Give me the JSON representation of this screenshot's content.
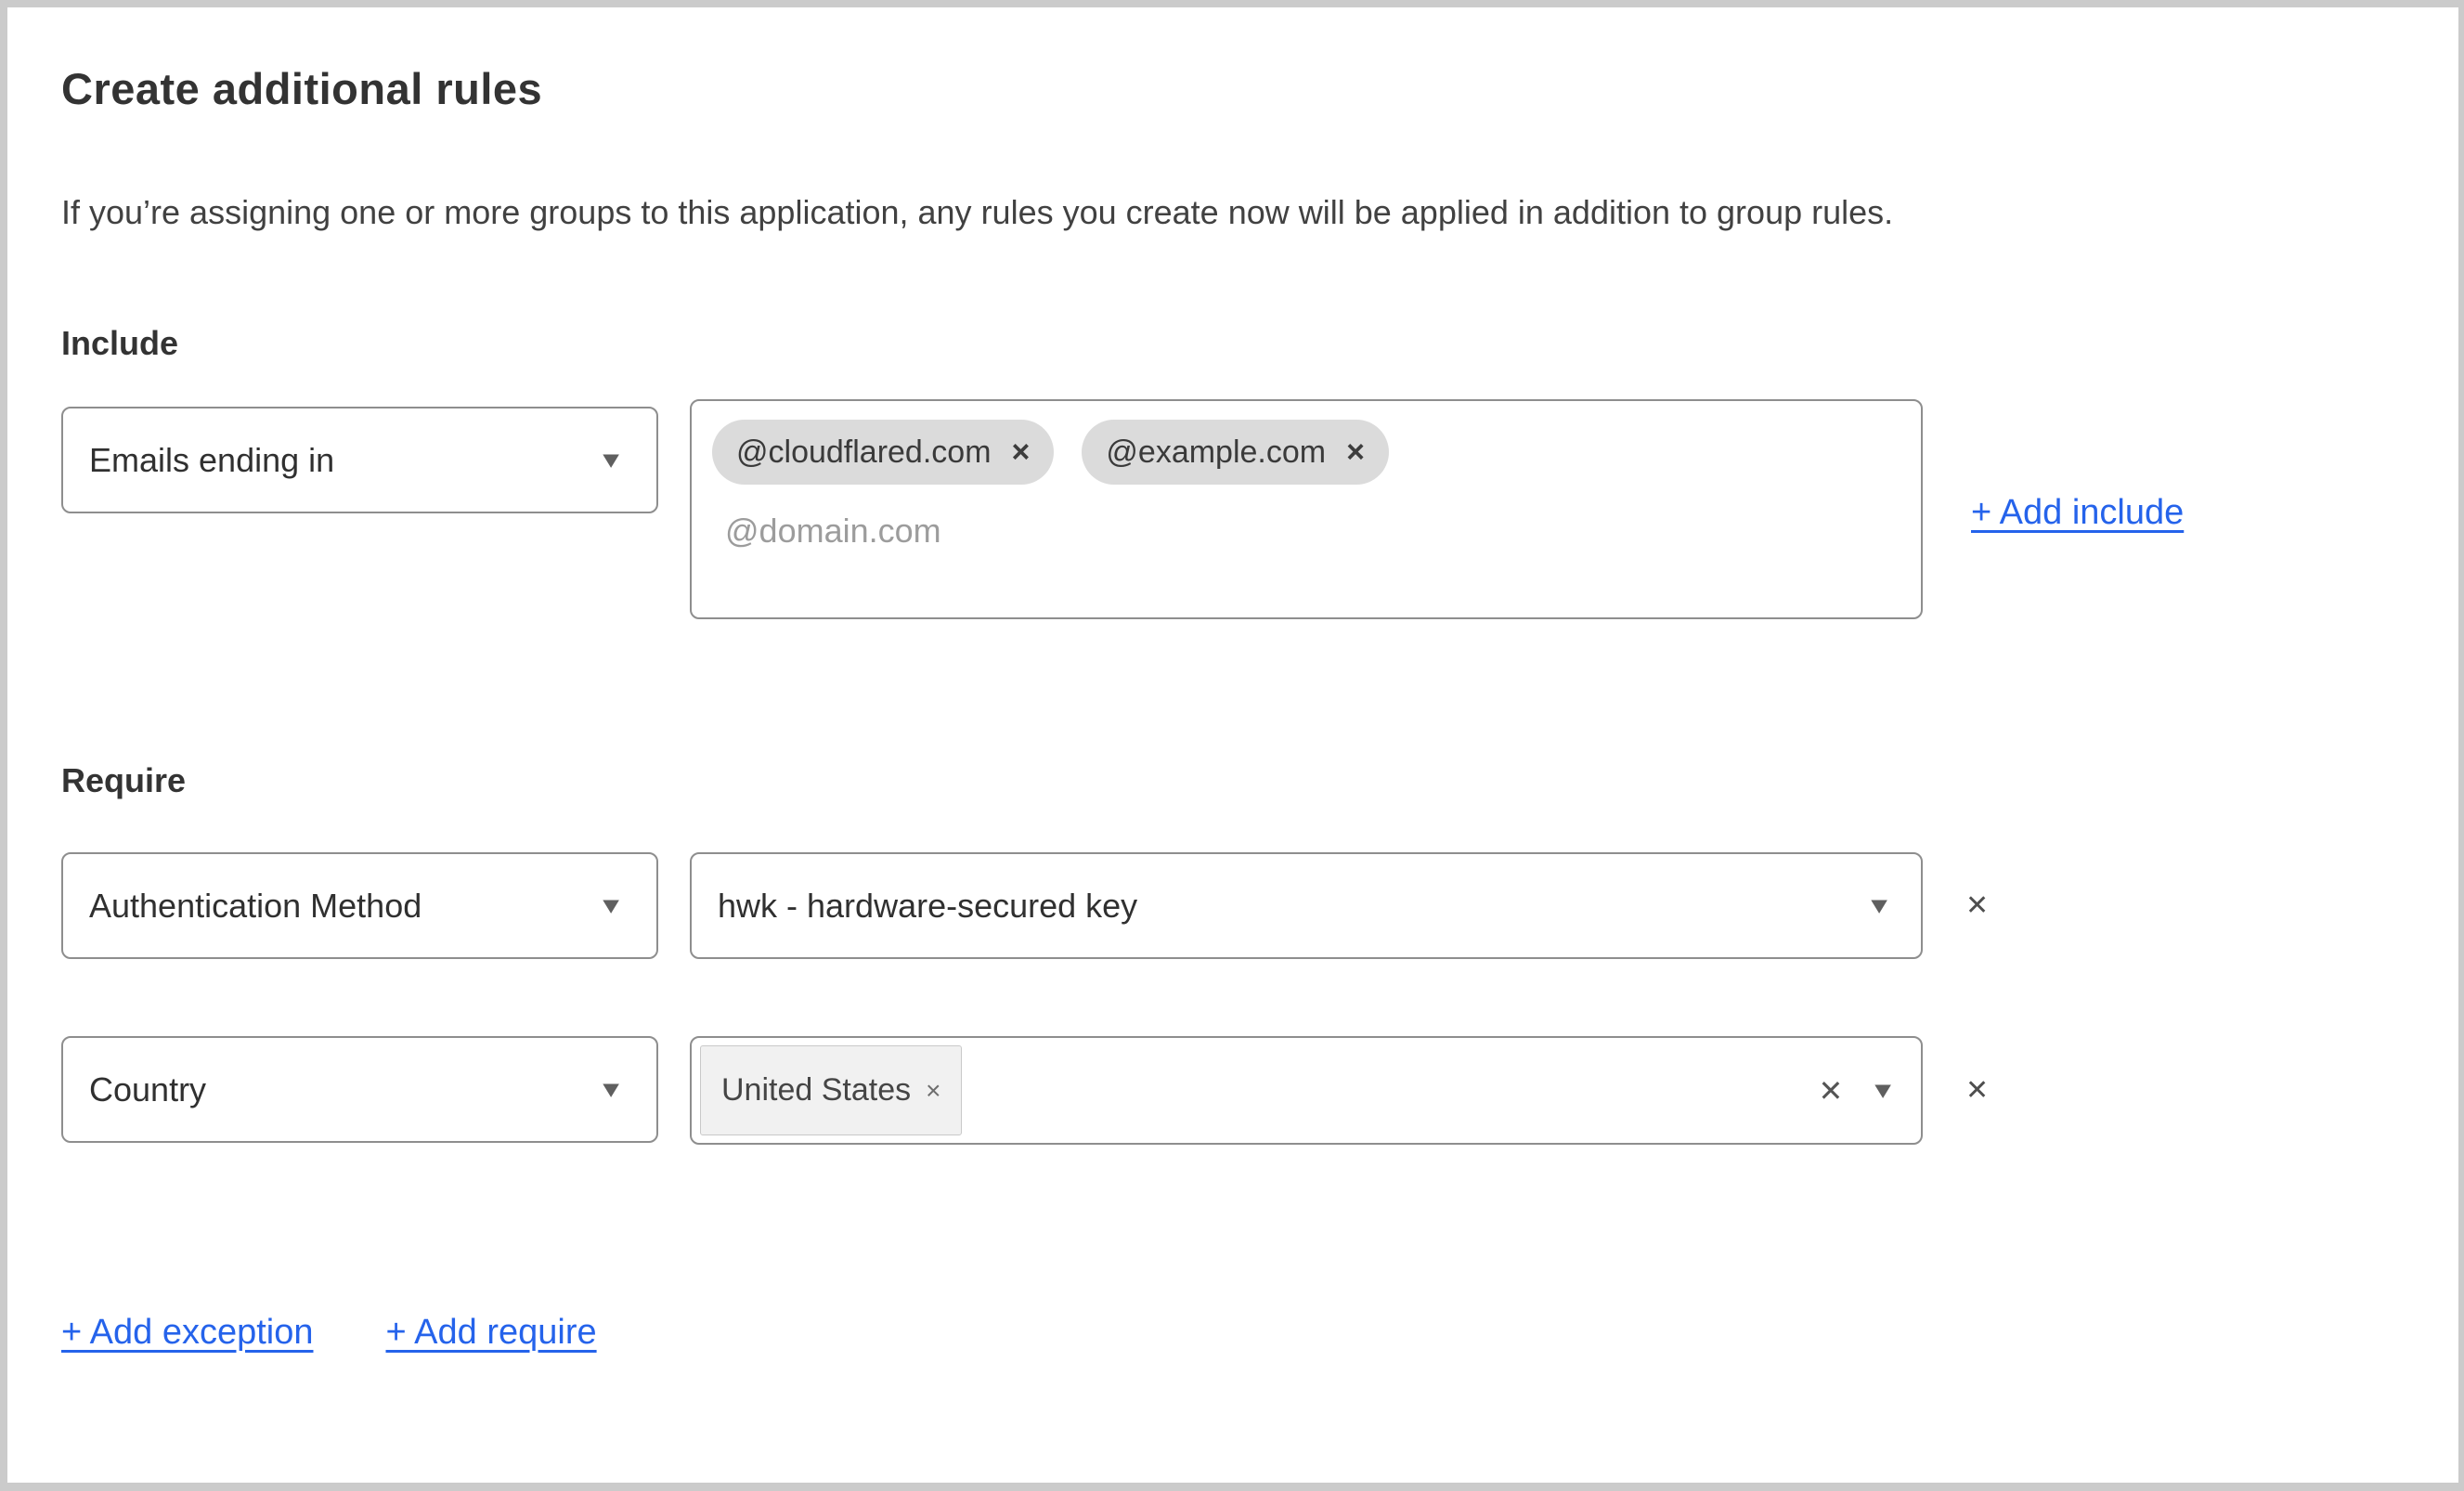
{
  "page": {
    "title": "Create additional rules",
    "description": "If you’re assigning one or more groups to this application, any rules you create now will be applied in addition to group rules."
  },
  "include_section": {
    "heading": "Include",
    "rule": {
      "selector_value": "Emails ending in",
      "tags": [
        {
          "label": "@cloudflared.com"
        },
        {
          "label": "@example.com"
        }
      ],
      "input_placeholder": "@domain.com"
    },
    "add_link_label": "+ Add include"
  },
  "require_section": {
    "heading": "Require",
    "rules": [
      {
        "selector_value": "Authentication Method",
        "value": "hwk - hardware-secured key"
      },
      {
        "selector_value": "Country",
        "chips": [
          {
            "label": "United States"
          }
        ]
      }
    ]
  },
  "footer": {
    "add_exception_label": "+ Add exception",
    "add_require_label": "+ Add require"
  },
  "icons": {
    "chevron_down": "▼",
    "chip_remove": "×",
    "row_remove": "✕",
    "clear": "✕"
  },
  "colors": {
    "link_blue": "#2563eb",
    "border_gray": "#8e8e8e",
    "chip_gray": "#dbdbdb",
    "frame_gray": "#cbcbcb"
  }
}
